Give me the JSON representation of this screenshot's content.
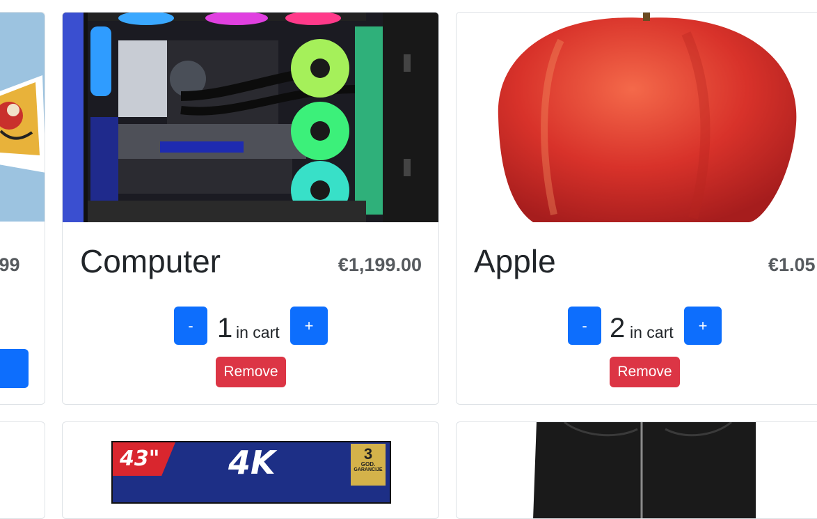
{
  "products": [
    {
      "price_partial": ".99"
    },
    {
      "name": "Computer",
      "price": "€1,199.00",
      "quantity": "1",
      "in_cart": "in cart",
      "minus": "-",
      "plus": "+",
      "remove": "Remove"
    },
    {
      "name": "Apple",
      "price": "€1.05",
      "quantity": "2",
      "in_cart": "in cart",
      "minus": "-",
      "plus": "+",
      "remove": "Remove"
    }
  ],
  "tv_banner": {
    "size": "43\"",
    "resolution": "4K",
    "guarantee_years": "3",
    "guarantee_unit": "GOD.",
    "guarantee_word": "GARANCIJE"
  },
  "colors": {
    "primary": "#0d6efd",
    "danger": "#dc3545",
    "border": "#dee2e6",
    "text": "#212529",
    "price": "#565a5e"
  }
}
